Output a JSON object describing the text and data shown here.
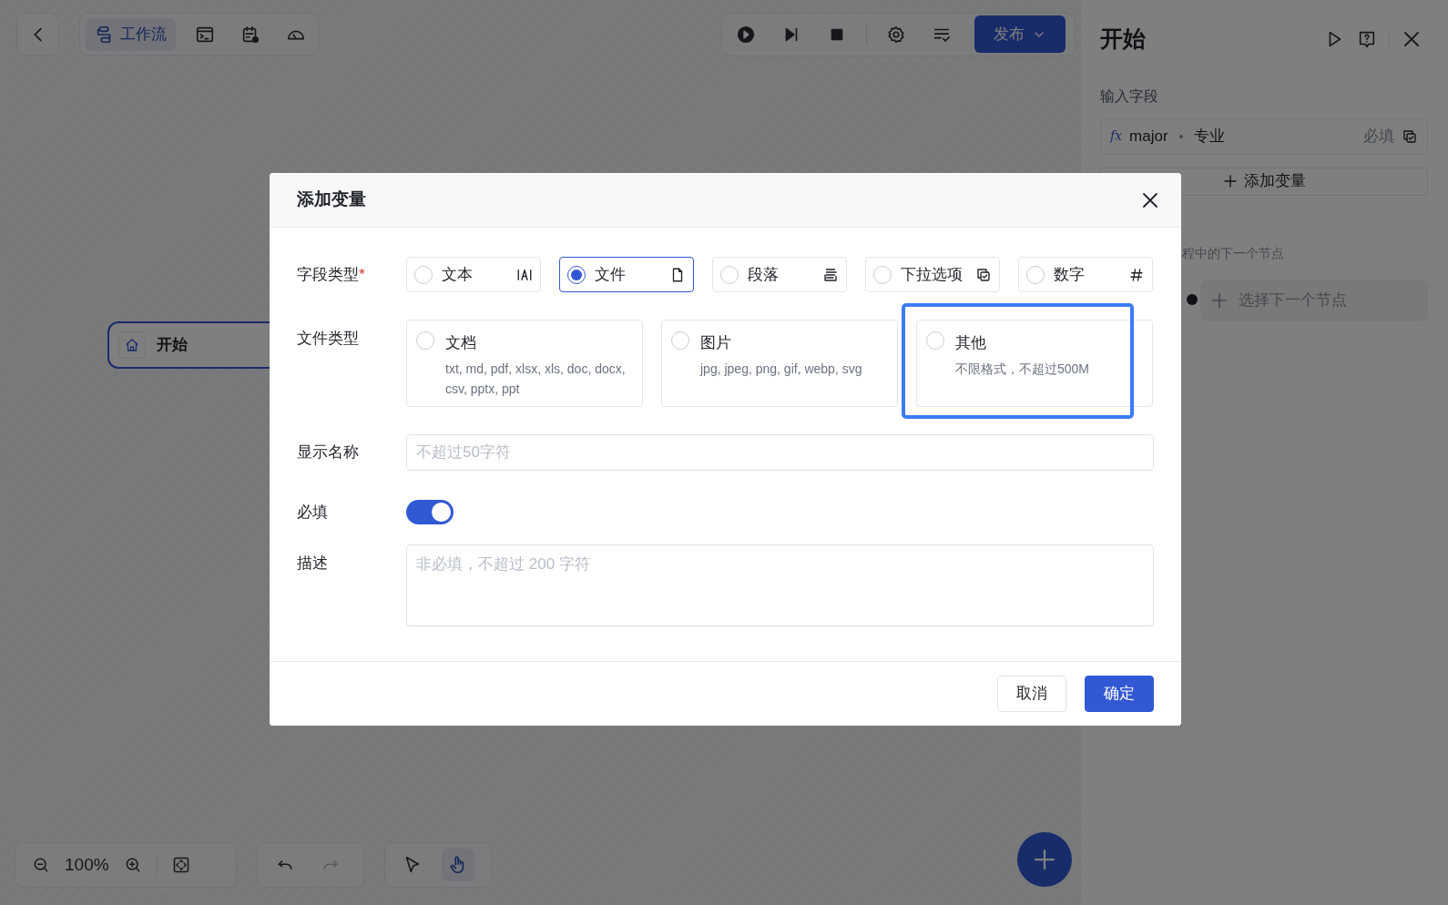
{
  "toolbar": {
    "tabs": [
      {
        "kind": "workflow",
        "label": "工作流",
        "selected": true
      },
      {
        "kind": "terminal",
        "selected": false
      },
      {
        "kind": "calendar",
        "selected": false
      },
      {
        "kind": "gauge",
        "selected": false
      }
    ],
    "publish_button": "发布"
  },
  "canvas": {
    "nodes": [
      {
        "label": "开始"
      }
    ],
    "zoom_reading": "100%",
    "tools": [
      {
        "kind": "pointer",
        "selected": false
      },
      {
        "kind": "hand",
        "selected": true
      }
    ]
  },
  "panel": {
    "title": "开始",
    "section_label": "输入字段",
    "fields": [
      {
        "icon_text": "fx",
        "name": "major",
        "label": "专业",
        "required": "必填"
      }
    ],
    "add_button": "添加变量",
    "next_label": "程中的下一个节点",
    "next_placeholder": "选择下一个节点"
  },
  "dialog": {
    "title": "添加变量",
    "field_type": {
      "label": "字段类型",
      "required_mark": "*",
      "options": [
        {
          "kind": "text",
          "label": "文本",
          "selected": false
        },
        {
          "kind": "file",
          "label": "文件",
          "selected": true
        },
        {
          "kind": "paragraph",
          "label": "段落",
          "selected": false
        },
        {
          "kind": "dropdown",
          "label": "下拉选项",
          "selected": false
        },
        {
          "kind": "number",
          "label": "数字",
          "selected": false
        }
      ]
    },
    "file_type": {
      "label": "文件类型",
      "options": [
        {
          "label": "文档",
          "description": "txt, md, pdf, xlsx, xls, doc, docx, csv, pptx, ppt",
          "selected": false,
          "highlighted": false
        },
        {
          "label": "图片",
          "description": "jpg, jpeg, png, gif, webp, svg",
          "selected": false,
          "highlighted": false
        },
        {
          "label": "其他",
          "description": "不限格式，不超过500M",
          "selected": false,
          "highlighted": true
        }
      ]
    },
    "display_name": {
      "label": "显示名称",
      "placeholder": "不超过50字符"
    },
    "required": {
      "label": "必填",
      "on": true
    },
    "description": {
      "label": "描述",
      "placeholder": "非必填，不超过 200 字符"
    },
    "buttons": [
      {
        "kind": "secondary",
        "label": "取消"
      },
      {
        "kind": "primary",
        "label": "确定"
      }
    ]
  }
}
